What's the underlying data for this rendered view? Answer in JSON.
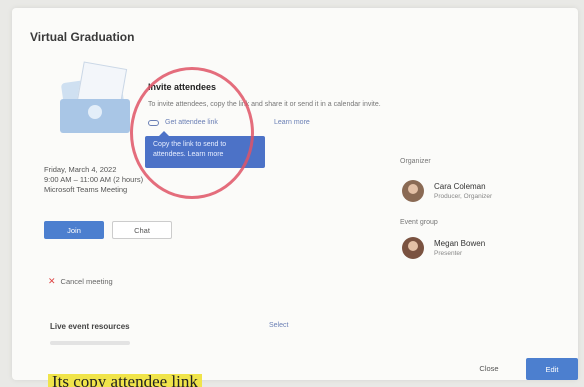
{
  "dialog": {
    "title": "Virtual Graduation"
  },
  "invite": {
    "heading": "Invite attendees",
    "description": "To invite attendees, copy the link and share it or send it in a calendar invite.",
    "copy_link_label": "Get attendee link",
    "learn_more": "Learn more",
    "tooltip": "Copy the link to send to attendees. Learn more"
  },
  "event": {
    "date": "Friday, March 4, 2022",
    "time": "9:00 AM – 11:00 AM (2 hours)",
    "location": "Microsoft Teams Meeting"
  },
  "buttons": {
    "join": "Join",
    "chat": "Chat",
    "close": "Close",
    "edit": "Edit"
  },
  "cancel": {
    "label": "Cancel meeting"
  },
  "resources": {
    "heading": "Live event resources",
    "link": "Select"
  },
  "sidebar": {
    "organizer_label": "Organizer",
    "organizer": {
      "name": "Cara Coleman",
      "role": "Producer, Organizer"
    },
    "group_label": "Event group",
    "member": {
      "name": "Megan Bowen",
      "role": "Presenter"
    }
  },
  "caption": "Its copy attendee link"
}
